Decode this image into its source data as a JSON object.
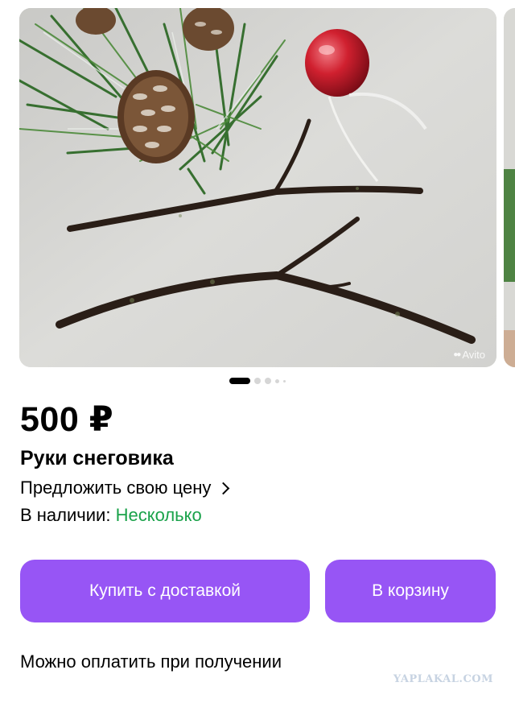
{
  "gallery": {
    "watermark": "Avito",
    "photo_count": 5,
    "active_index": 0
  },
  "listing": {
    "price": "500 ₽",
    "title": "Руки снеговика",
    "offer_price_label": "Предложить свою цену",
    "availability_label": "В наличии:",
    "availability_value": "Несколько"
  },
  "actions": {
    "buy_with_delivery": "Купить с доставкой",
    "add_to_cart": "В корзину"
  },
  "payment_note": "Можно оплатить при получении",
  "site_watermark": "YAPLAKAL.COM",
  "colors": {
    "accent": "#9755f5",
    "in_stock": "#1aa24a"
  }
}
